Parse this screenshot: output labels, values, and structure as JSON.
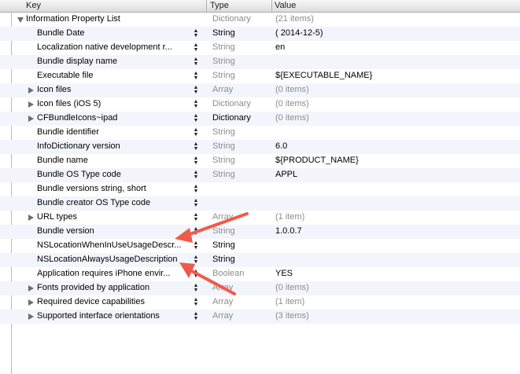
{
  "header": {
    "key": "Key",
    "type": "Type",
    "value": "Value"
  },
  "rows": [
    {
      "key": "Information Property List",
      "type": "Dictionary",
      "value": "(21 items)",
      "expand": "down",
      "level": 0,
      "stepper": false,
      "type_dim": true,
      "value_dim": true
    },
    {
      "key": "Bundle Date",
      "type": "String",
      "value": "( 2014-12-5)",
      "expand": "",
      "level": 1,
      "stepper": true,
      "type_dim": false,
      "value_dim": false
    },
    {
      "key": "Localization native development r...",
      "type": "String",
      "value": "en",
      "expand": "",
      "level": 1,
      "stepper": true,
      "type_dim": true,
      "value_dim": false
    },
    {
      "key": "Bundle display name",
      "type": "String",
      "value": "",
      "expand": "",
      "level": 1,
      "stepper": true,
      "type_dim": true,
      "value_dim": false
    },
    {
      "key": "Executable file",
      "type": "String",
      "value": "${EXECUTABLE_NAME}",
      "expand": "",
      "level": 1,
      "stepper": true,
      "type_dim": true,
      "value_dim": false
    },
    {
      "key": "Icon files",
      "type": "Array",
      "value": "(0 items)",
      "expand": "right",
      "level": 1,
      "stepper": true,
      "type_dim": true,
      "value_dim": true
    },
    {
      "key": "Icon files (iOS 5)",
      "type": "Dictionary",
      "value": "(0 items)",
      "expand": "right",
      "level": 1,
      "stepper": true,
      "type_dim": true,
      "value_dim": true
    },
    {
      "key": "CFBundleIcons~ipad",
      "type": "Dictionary",
      "value": "(0 items)",
      "expand": "right",
      "level": 1,
      "stepper": true,
      "type_dim": false,
      "value_dim": true
    },
    {
      "key": "Bundle identifier",
      "type": "String",
      "value": "",
      "expand": "",
      "level": 1,
      "stepper": true,
      "type_dim": true,
      "value_dim": false
    },
    {
      "key": "InfoDictionary version",
      "type": "String",
      "value": "6.0",
      "expand": "",
      "level": 1,
      "stepper": true,
      "type_dim": true,
      "value_dim": false
    },
    {
      "key": "Bundle name",
      "type": "String",
      "value": "${PRODUCT_NAME}",
      "expand": "",
      "level": 1,
      "stepper": true,
      "type_dim": true,
      "value_dim": false
    },
    {
      "key": "Bundle OS Type code",
      "type": "String",
      "value": "APPL",
      "expand": "",
      "level": 1,
      "stepper": true,
      "type_dim": true,
      "value_dim": false
    },
    {
      "key": "Bundle versions string, short",
      "type": "",
      "value": "",
      "expand": "",
      "level": 1,
      "stepper": true,
      "type_dim": true,
      "value_dim": false
    },
    {
      "key": "Bundle creator OS Type code",
      "type": "",
      "value": "",
      "expand": "",
      "level": 1,
      "stepper": true,
      "type_dim": true,
      "value_dim": false
    },
    {
      "key": "URL types",
      "type": "Array",
      "value": "(1 item)",
      "expand": "right",
      "level": 1,
      "stepper": true,
      "type_dim": true,
      "value_dim": true
    },
    {
      "key": "Bundle version",
      "type": "String",
      "value": "1.0.0.7",
      "expand": "",
      "level": 1,
      "stepper": true,
      "type_dim": true,
      "value_dim": false
    },
    {
      "key": "NSLocationWhenInUseUsageDescr...",
      "type": "String",
      "value": "",
      "expand": "",
      "level": 1,
      "stepper": true,
      "type_dim": false,
      "value_dim": false
    },
    {
      "key": "NSLocationAlwaysUsageDescription",
      "type": "String",
      "value": "",
      "expand": "",
      "level": 1,
      "stepper": true,
      "type_dim": false,
      "value_dim": false
    },
    {
      "key": "Application requires iPhone envir...",
      "type": "Boolean",
      "value": "YES",
      "expand": "",
      "level": 1,
      "stepper": true,
      "type_dim": true,
      "value_dim": false
    },
    {
      "key": "Fonts provided by application",
      "type": "Array",
      "value": "(0 items)",
      "expand": "right",
      "level": 1,
      "stepper": true,
      "type_dim": true,
      "value_dim": true
    },
    {
      "key": "Required device capabilities",
      "type": "Array",
      "value": "(1 item)",
      "expand": "right",
      "level": 1,
      "stepper": true,
      "type_dim": true,
      "value_dim": true
    },
    {
      "key": "Supported interface orientations",
      "type": "Array",
      "value": "(3 items)",
      "expand": "right",
      "level": 1,
      "stepper": true,
      "type_dim": true,
      "value_dim": true
    }
  ],
  "annotation": {
    "arrow_color": "#f05a4a"
  }
}
